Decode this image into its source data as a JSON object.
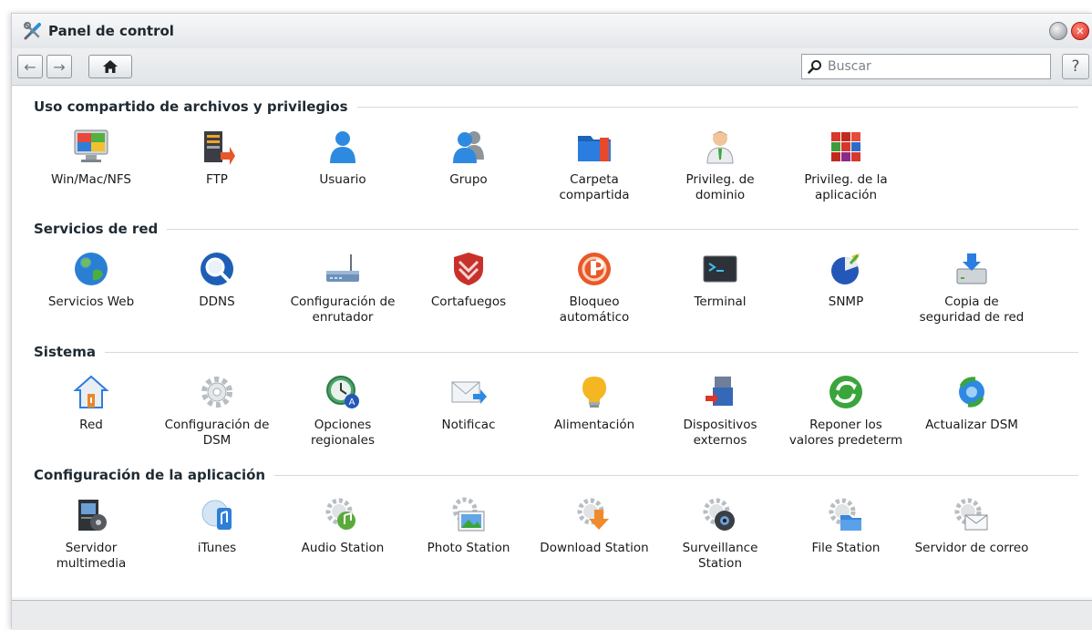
{
  "window": {
    "title": "Panel de control"
  },
  "toolbar": {
    "back_icon": "arrow-left-icon",
    "forward_icon": "arrow-right-icon",
    "home_icon": "home-icon",
    "search_placeholder": "Buscar",
    "help_label": "?"
  },
  "sections": [
    {
      "title": "Uso compartido de archivos y privilegios",
      "items": [
        {
          "label": "Win/Mac/NFS",
          "icon": "monitor-icon"
        },
        {
          "label": "FTP",
          "icon": "ftp-server-icon"
        },
        {
          "label": "Usuario",
          "icon": "user-icon"
        },
        {
          "label": "Grupo",
          "icon": "group-icon"
        },
        {
          "label": "Carpeta compartida",
          "icon": "shared-folder-icon"
        },
        {
          "label": "Privileg. de dominio",
          "icon": "domain-user-icon"
        },
        {
          "label": "Privileg. de la aplicación",
          "icon": "app-privilege-cube-icon"
        }
      ]
    },
    {
      "title": "Servicios de red",
      "items": [
        {
          "label": "Servicios Web",
          "icon": "globe-icon"
        },
        {
          "label": "DDNS",
          "icon": "ddns-magnifier-icon"
        },
        {
          "label": "Configuración de enrutador",
          "icon": "router-icon"
        },
        {
          "label": "Cortafuegos",
          "icon": "firewall-shield-icon"
        },
        {
          "label": "Bloqueo automático",
          "icon": "auto-block-icon"
        },
        {
          "label": "Terminal",
          "icon": "terminal-icon"
        },
        {
          "label": "SNMP",
          "icon": "snmp-pie-icon"
        },
        {
          "label": "Copia de seguridad de red",
          "icon": "network-backup-icon"
        }
      ]
    },
    {
      "title": "Sistema",
      "items": [
        {
          "label": "Red",
          "icon": "house-network-icon"
        },
        {
          "label": "Configuración de DSM",
          "icon": "gear-icon"
        },
        {
          "label": "Opciones regionales",
          "icon": "clock-regional-icon"
        },
        {
          "label": "Notificac",
          "icon": "envelope-icon"
        },
        {
          "label": "Alimentación",
          "icon": "light-bulb-icon"
        },
        {
          "label": "Dispositivos externos",
          "icon": "usb-device-icon"
        },
        {
          "label": "Reponer los valores predeterm",
          "icon": "reset-arrows-icon"
        },
        {
          "label": "Actualizar DSM",
          "icon": "update-refresh-icon"
        }
      ]
    },
    {
      "title": "Configuración de la aplicación",
      "items": [
        {
          "label": "Servidor multimedia",
          "icon": "media-server-icon"
        },
        {
          "label": "iTunes",
          "icon": "itunes-icon"
        },
        {
          "label": "Audio Station",
          "icon": "audio-station-icon"
        },
        {
          "label": "Photo Station",
          "icon": "photo-station-icon"
        },
        {
          "label": "Download Station",
          "icon": "download-station-icon"
        },
        {
          "label": "Surveillance Station",
          "icon": "surveillance-camera-icon"
        },
        {
          "label": "File Station",
          "icon": "file-station-icon"
        },
        {
          "label": "Servidor de correo",
          "icon": "mail-server-icon"
        }
      ]
    }
  ]
}
